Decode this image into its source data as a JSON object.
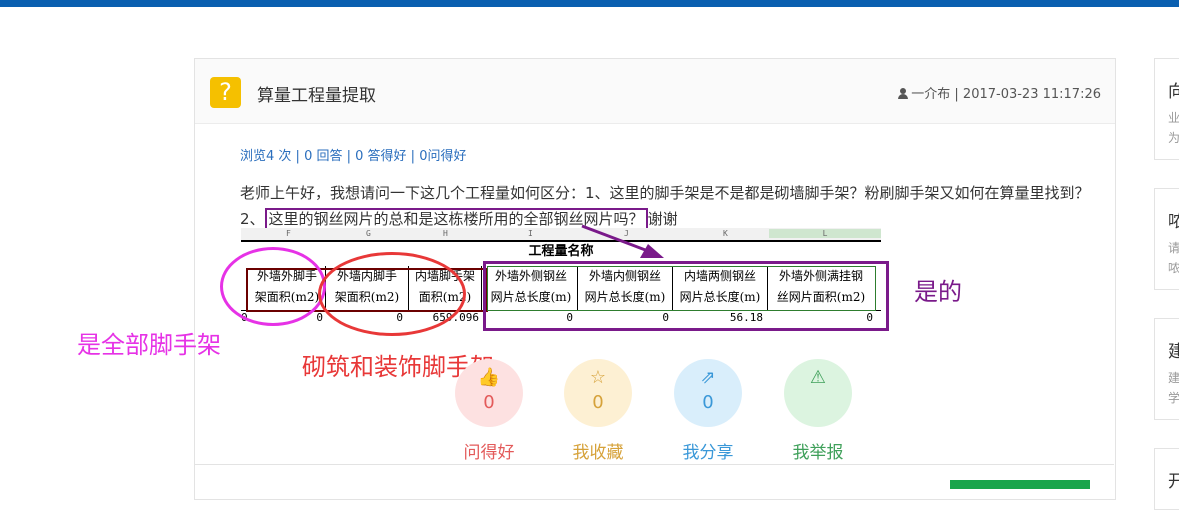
{
  "question": {
    "title": "算量工程量提取",
    "author": "一介布",
    "datetime": "2017-03-23 11:17:26",
    "stats": {
      "views": "浏览4 次",
      "answers": "0 回答",
      "good_answers": "0 答得好",
      "good_questions": "0问得好",
      "sep": " | "
    },
    "body_part1": "老师上午好，我想请问一下这几个工程量如何区分：1、这里的脚手架是不是都是砌墙脚手架？粉刷脚手架又如何在算量里找到？2、",
    "body_highlight": "这里的钢丝网片的总和是这栋楼所用的全部钢丝网片吗？",
    "body_part3": "谢谢"
  },
  "sheet": {
    "columns": [
      "F",
      "G",
      "H",
      "I",
      "J",
      "K",
      "L"
    ],
    "title": "工程量名称",
    "headers": [
      {
        "line1": "外墙外脚手",
        "line2": "架面积(m2)"
      },
      {
        "line1": "外墙内脚手",
        "line2": "架面积(m2)"
      },
      {
        "line1": "内墙脚手架",
        "line2": "面积(m2)"
      },
      {
        "line1": "外墙外侧钢丝",
        "line2": "网片总长度(m)"
      },
      {
        "line1": "外墙内侧钢丝",
        "line2": "网片总长度(m)"
      },
      {
        "line1": "内墙两侧钢丝",
        "line2": "网片总长度(m)"
      },
      {
        "line1": "外墙外侧满挂钢",
        "line2": "丝网片面积(m2)"
      }
    ],
    "values": [
      "0",
      "0",
      "0",
      "659.096",
      "0",
      "0",
      "56.18",
      "0"
    ]
  },
  "annotations": {
    "all_scaffold": "是全部脚手架",
    "masonry_scaffold": "砌筑和装饰脚手架",
    "yes": "是的"
  },
  "actions": [
    {
      "count": "0",
      "label": "问得好",
      "icon": "thumbs-up-icon",
      "bg": "#fde1e1",
      "fg": "#e35a5a"
    },
    {
      "count": "0",
      "label": "我收藏",
      "icon": "star-icon",
      "bg": "#fdf0d3",
      "fg": "#d6a23a"
    },
    {
      "count": "0",
      "label": "我分享",
      "icon": "share-icon",
      "bg": "#d9eefb",
      "fg": "#3a98d8"
    },
    {
      "count": "0",
      "label": "我举报",
      "icon": "warning-icon",
      "bg": "#dcf4e0",
      "fg": "#3fa05a"
    }
  ],
  "sidebar": [
    {
      "title": "向",
      "sub1": "业",
      "sub2": "为"
    },
    {
      "title": "哝",
      "sub1": "请",
      "sub2": "哝"
    },
    {
      "title": "建",
      "sub1": "建",
      "sub2": "学"
    },
    {
      "title": "开",
      "sub1": "",
      "sub2": ""
    }
  ],
  "colors": {
    "topbar": "#0a5fb0",
    "stats_link": "#2a6ebd",
    "question_icon": "#f5c000",
    "annotation_magenta": "#e632e6",
    "annotation_red": "#e83838",
    "annotation_purple": "#7a1a8a"
  }
}
